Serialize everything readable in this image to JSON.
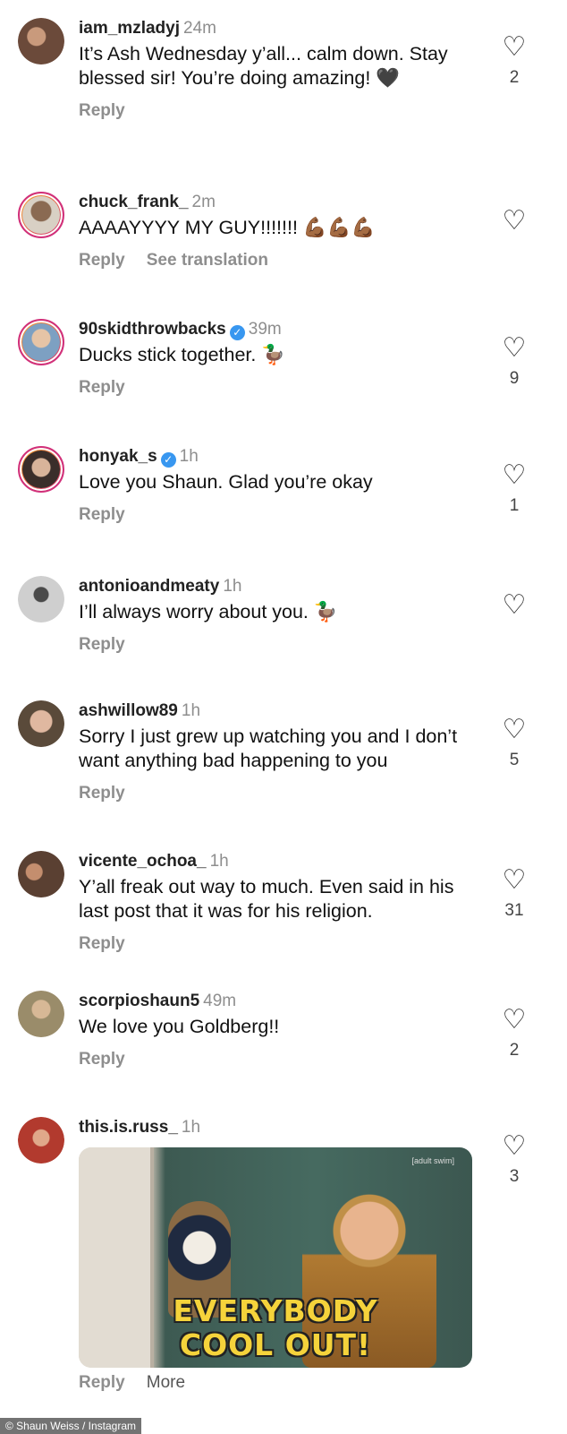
{
  "comments": [
    {
      "username": "iam_mzladyj",
      "time": "24m",
      "verified": false,
      "text": "It’s Ash Wednesday y’all... calm down. Stay blessed sir! You’re doing amazing! 🖤",
      "reply": "Reply",
      "likes": "2",
      "ring": false,
      "avatar_color": "#6b4a3a"
    },
    {
      "username": "chuck_frank_",
      "time": "2m",
      "verified": false,
      "text": "AAAAYYYY MY GUY!!!!!!! 💪🏾💪🏾💪🏾",
      "reply": "Reply",
      "translate": "See translation",
      "likes": "",
      "ring": true,
      "avatar_color": "#8a7a66"
    },
    {
      "username": "90skidthrowbacks",
      "time": "39m",
      "verified": true,
      "text": "Ducks stick together. 🦆",
      "reply": "Reply",
      "likes": "9",
      "ring": true,
      "avatar_color": "#7da0c2"
    },
    {
      "username": "honyak_s",
      "time": "1h",
      "verified": true,
      "text": "Love you Shaun. Glad you’re okay",
      "reply": "Reply",
      "likes": "1",
      "ring": true,
      "avatar_color": "#6a5a50"
    },
    {
      "username": "antonioandmeaty",
      "time": "1h",
      "verified": false,
      "text": "I’ll always worry about you. 🦆",
      "reply": "Reply",
      "likes": "",
      "ring": false,
      "avatar_color": "#9a9a9a"
    },
    {
      "username": "ashwillow89",
      "time": "1h",
      "verified": false,
      "text": "Sorry I just grew up watching you and I don’t want anything bad happening to you",
      "reply": "Reply",
      "likes": "5",
      "ring": false,
      "avatar_color": "#b78f78"
    },
    {
      "username": "vicente_ochoa_",
      "time": "1h",
      "verified": false,
      "text": "Y’all freak out way to much. Even said in his last post that it was for his religion.",
      "reply": "Reply",
      "likes": "31",
      "ring": false,
      "avatar_color": "#5a4032"
    },
    {
      "username": "scorpioshaun5",
      "time": "49m",
      "verified": false,
      "text": "We love you Goldberg!!",
      "reply": "Reply",
      "likes": "2",
      "ring": false,
      "avatar_color": "#9a8c6a"
    },
    {
      "username": "this.is.russ_",
      "time": "1h",
      "verified": false,
      "text": "",
      "reply": "Reply",
      "more": "More",
      "likes": "3",
      "ring": false,
      "avatar_color": "#b23a2e",
      "gif_caption_1": "EVERYBODY",
      "gif_caption_2": "COOL OUT!",
      "gif_tag": "[adult swim]"
    }
  ],
  "credit": "© Shaun Weiss / Instagram",
  "icons": {
    "heart": "heart-outline-icon",
    "verified": "verified-badge-icon"
  }
}
